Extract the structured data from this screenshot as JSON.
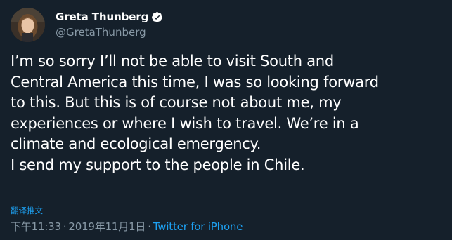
{
  "author": {
    "display_name": "Greta Thunberg",
    "handle": "@GretaThunberg",
    "verified": true,
    "avatar_icon": "profile-photo"
  },
  "tweet": {
    "lines": [
      "I’m so sorry I’ll not be able to visit South and",
      "Central America this time, I was so looking forward",
      "to this. But this is of course not about me, my",
      "experiences or where I wish to travel. We’re in a",
      "climate and ecological emergency.",
      "I send my support to the people in Chile."
    ]
  },
  "translate_label": "翻译推文",
  "meta": {
    "time": "下午11:33",
    "date": "2019年11月1日",
    "separator": "·",
    "source": "Twitter for iPhone"
  },
  "colors": {
    "background": "#15202b",
    "text": "#ffffff",
    "secondary": "#8899a6",
    "link": "#1da1f2"
  }
}
